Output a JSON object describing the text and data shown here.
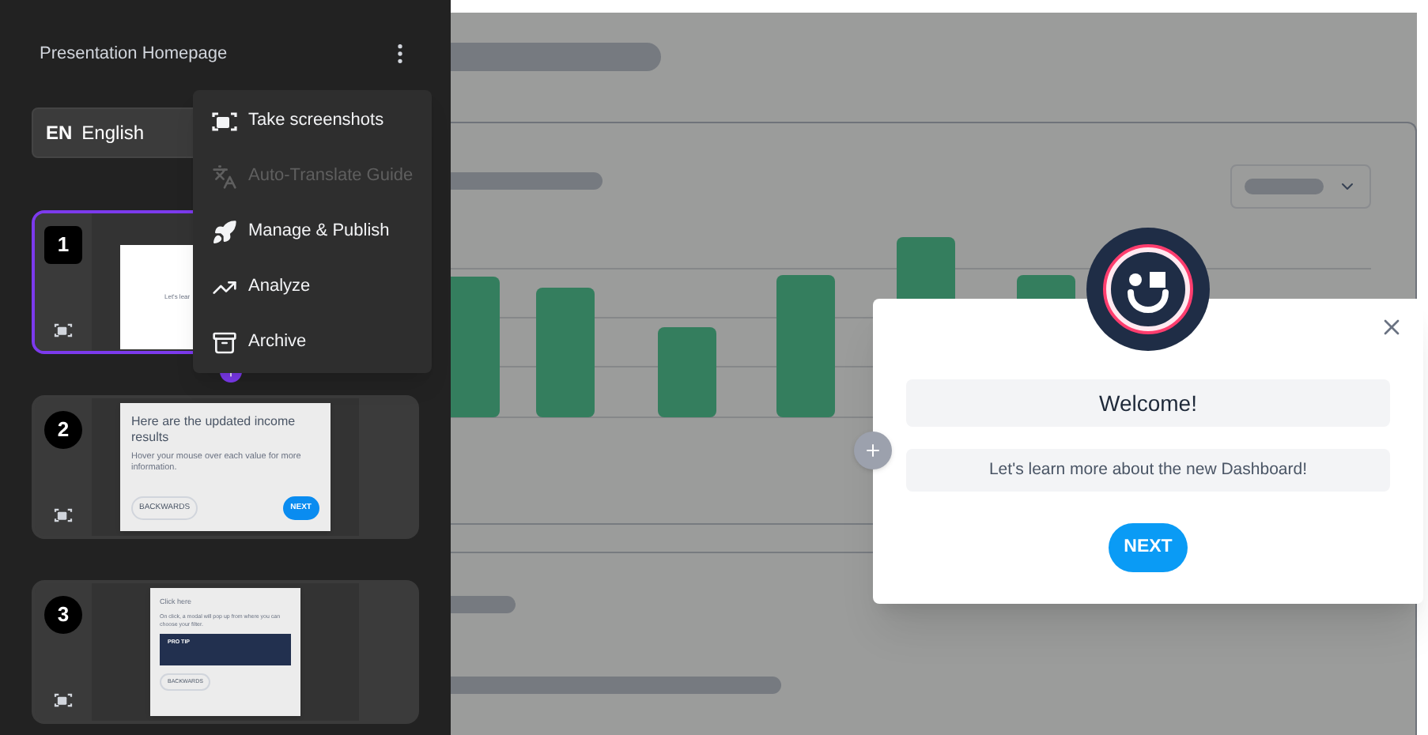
{
  "sidebar": {
    "title": "Presentation Homepage",
    "language": {
      "code": "EN",
      "name": "English"
    },
    "steps": [
      {
        "number": "1",
        "selected": true,
        "thumbnail": {
          "kind": "welcome",
          "text": "Let's lear"
        }
      },
      {
        "number": "2",
        "selected": false,
        "thumbnail": {
          "kind": "message",
          "title": "Here are the updated income results",
          "body": "Hover your mouse over each value for more information.",
          "back": "BACKWARDS",
          "next": "NEXT"
        }
      },
      {
        "number": "3",
        "selected": false,
        "thumbnail": {
          "kind": "tip",
          "title": "Click here",
          "body": "On click, a modal will pop up from where you can choose your filter.",
          "tip": "PRO TIP",
          "back": "BACKWARDS"
        }
      }
    ]
  },
  "menu": {
    "items": [
      {
        "kind": "screenshot",
        "label": "Take screenshots",
        "disabled": false
      },
      {
        "kind": "translate",
        "label": "Auto-Translate Guide",
        "disabled": true
      },
      {
        "kind": "publish",
        "label": "Manage & Publish",
        "disabled": false
      },
      {
        "kind": "analytics",
        "label": "Analyze",
        "disabled": false
      },
      {
        "kind": "archive",
        "label": "Archive",
        "disabled": false
      }
    ]
  },
  "modal": {
    "title": "Welcome!",
    "subtitle": "Let's learn more about the new Dashboard!",
    "button": "NEXT"
  }
}
